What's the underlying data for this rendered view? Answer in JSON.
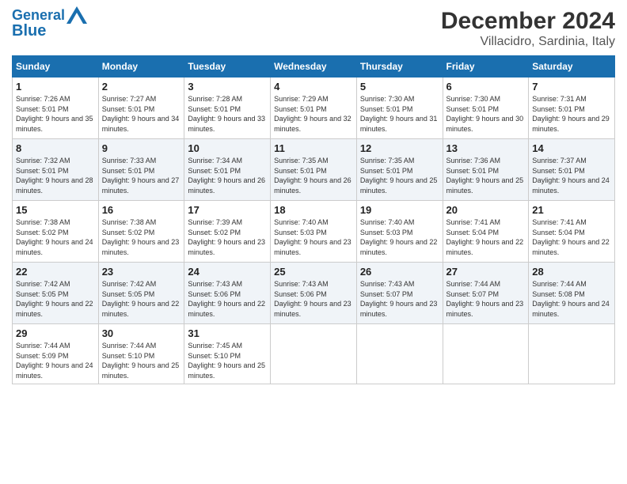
{
  "header": {
    "logo_line1": "General",
    "logo_line2": "Blue",
    "title": "December 2024",
    "subtitle": "Villacidro, Sardinia, Italy"
  },
  "columns": [
    "Sunday",
    "Monday",
    "Tuesday",
    "Wednesday",
    "Thursday",
    "Friday",
    "Saturday"
  ],
  "weeks": [
    [
      {
        "day": "1",
        "sunrise": "7:26 AM",
        "sunset": "5:01 PM",
        "daylight": "9 hours and 35 minutes."
      },
      {
        "day": "2",
        "sunrise": "7:27 AM",
        "sunset": "5:01 PM",
        "daylight": "9 hours and 34 minutes."
      },
      {
        "day": "3",
        "sunrise": "7:28 AM",
        "sunset": "5:01 PM",
        "daylight": "9 hours and 33 minutes."
      },
      {
        "day": "4",
        "sunrise": "7:29 AM",
        "sunset": "5:01 PM",
        "daylight": "9 hours and 32 minutes."
      },
      {
        "day": "5",
        "sunrise": "7:30 AM",
        "sunset": "5:01 PM",
        "daylight": "9 hours and 31 minutes."
      },
      {
        "day": "6",
        "sunrise": "7:30 AM",
        "sunset": "5:01 PM",
        "daylight": "9 hours and 30 minutes."
      },
      {
        "day": "7",
        "sunrise": "7:31 AM",
        "sunset": "5:01 PM",
        "daylight": "9 hours and 29 minutes."
      }
    ],
    [
      {
        "day": "8",
        "sunrise": "7:32 AM",
        "sunset": "5:01 PM",
        "daylight": "9 hours and 28 minutes."
      },
      {
        "day": "9",
        "sunrise": "7:33 AM",
        "sunset": "5:01 PM",
        "daylight": "9 hours and 27 minutes."
      },
      {
        "day": "10",
        "sunrise": "7:34 AM",
        "sunset": "5:01 PM",
        "daylight": "9 hours and 26 minutes."
      },
      {
        "day": "11",
        "sunrise": "7:35 AM",
        "sunset": "5:01 PM",
        "daylight": "9 hours and 26 minutes."
      },
      {
        "day": "12",
        "sunrise": "7:35 AM",
        "sunset": "5:01 PM",
        "daylight": "9 hours and 25 minutes."
      },
      {
        "day": "13",
        "sunrise": "7:36 AM",
        "sunset": "5:01 PM",
        "daylight": "9 hours and 25 minutes."
      },
      {
        "day": "14",
        "sunrise": "7:37 AM",
        "sunset": "5:01 PM",
        "daylight": "9 hours and 24 minutes."
      }
    ],
    [
      {
        "day": "15",
        "sunrise": "7:38 AM",
        "sunset": "5:02 PM",
        "daylight": "9 hours and 24 minutes."
      },
      {
        "day": "16",
        "sunrise": "7:38 AM",
        "sunset": "5:02 PM",
        "daylight": "9 hours and 23 minutes."
      },
      {
        "day": "17",
        "sunrise": "7:39 AM",
        "sunset": "5:02 PM",
        "daylight": "9 hours and 23 minutes."
      },
      {
        "day": "18",
        "sunrise": "7:40 AM",
        "sunset": "5:03 PM",
        "daylight": "9 hours and 23 minutes."
      },
      {
        "day": "19",
        "sunrise": "7:40 AM",
        "sunset": "5:03 PM",
        "daylight": "9 hours and 22 minutes."
      },
      {
        "day": "20",
        "sunrise": "7:41 AM",
        "sunset": "5:04 PM",
        "daylight": "9 hours and 22 minutes."
      },
      {
        "day": "21",
        "sunrise": "7:41 AM",
        "sunset": "5:04 PM",
        "daylight": "9 hours and 22 minutes."
      }
    ],
    [
      {
        "day": "22",
        "sunrise": "7:42 AM",
        "sunset": "5:05 PM",
        "daylight": "9 hours and 22 minutes."
      },
      {
        "day": "23",
        "sunrise": "7:42 AM",
        "sunset": "5:05 PM",
        "daylight": "9 hours and 22 minutes."
      },
      {
        "day": "24",
        "sunrise": "7:43 AM",
        "sunset": "5:06 PM",
        "daylight": "9 hours and 22 minutes."
      },
      {
        "day": "25",
        "sunrise": "7:43 AM",
        "sunset": "5:06 PM",
        "daylight": "9 hours and 23 minutes."
      },
      {
        "day": "26",
        "sunrise": "7:43 AM",
        "sunset": "5:07 PM",
        "daylight": "9 hours and 23 minutes."
      },
      {
        "day": "27",
        "sunrise": "7:44 AM",
        "sunset": "5:07 PM",
        "daylight": "9 hours and 23 minutes."
      },
      {
        "day": "28",
        "sunrise": "7:44 AM",
        "sunset": "5:08 PM",
        "daylight": "9 hours and 24 minutes."
      }
    ],
    [
      {
        "day": "29",
        "sunrise": "7:44 AM",
        "sunset": "5:09 PM",
        "daylight": "9 hours and 24 minutes."
      },
      {
        "day": "30",
        "sunrise": "7:44 AM",
        "sunset": "5:10 PM",
        "daylight": "9 hours and 25 minutes."
      },
      {
        "day": "31",
        "sunrise": "7:45 AM",
        "sunset": "5:10 PM",
        "daylight": "9 hours and 25 minutes."
      },
      null,
      null,
      null,
      null
    ]
  ]
}
